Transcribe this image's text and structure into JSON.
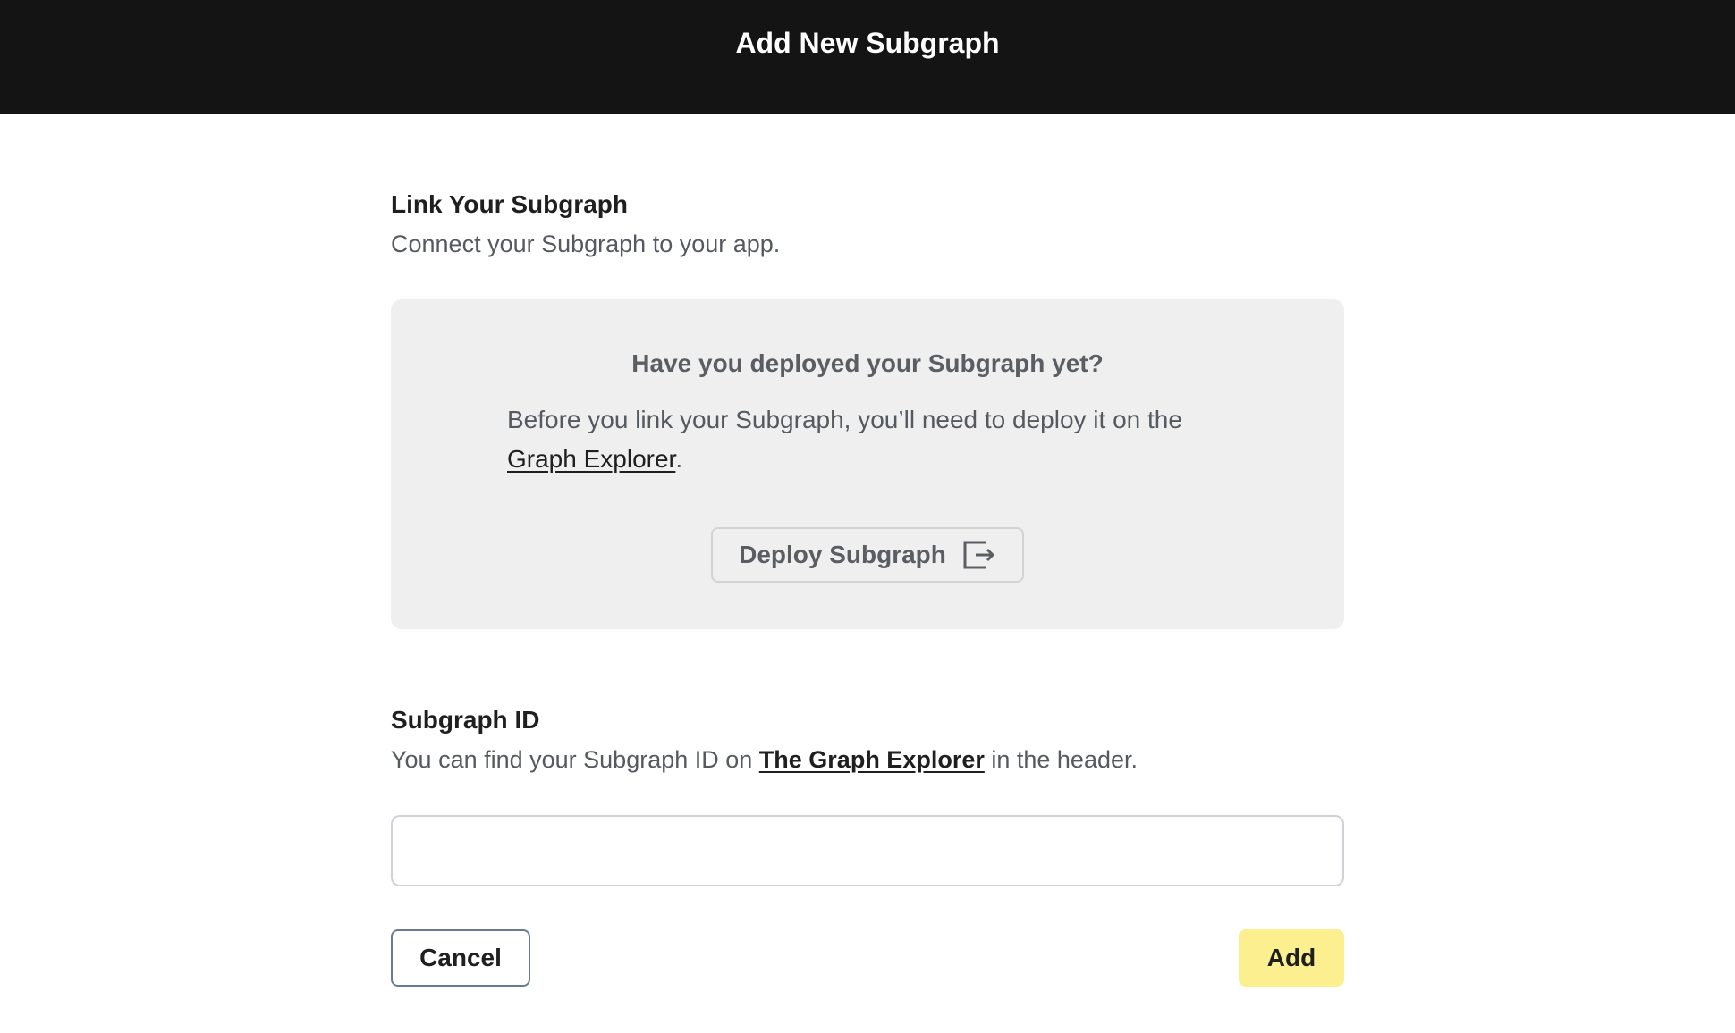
{
  "header": {
    "title": "Add New Subgraph"
  },
  "link_section": {
    "title": "Link Your Subgraph",
    "description": "Connect your Subgraph to your app."
  },
  "notice": {
    "heading": "Have you deployed your Subgraph yet?",
    "body_prefix": "Before you link your Subgraph, you’ll need to deploy it on the ",
    "link_text": "Graph Explorer",
    "body_suffix": ".",
    "deploy_button_label": "Deploy Subgraph",
    "deploy_button_icon": "external-link-icon"
  },
  "subgraph_id_section": {
    "title": "Subgraph ID",
    "description_prefix": "You can find your Subgraph ID on ",
    "link_text": "The Graph Explorer",
    "description_suffix": " in the header.",
    "input_value": "",
    "input_placeholder": ""
  },
  "actions": {
    "cancel_label": "Cancel",
    "add_label": "Add"
  },
  "colors": {
    "header_bg": "#141414",
    "notice_bg": "#efefef",
    "add_button_bg": "#fbef8f",
    "cancel_border": "#6b7c8f"
  }
}
